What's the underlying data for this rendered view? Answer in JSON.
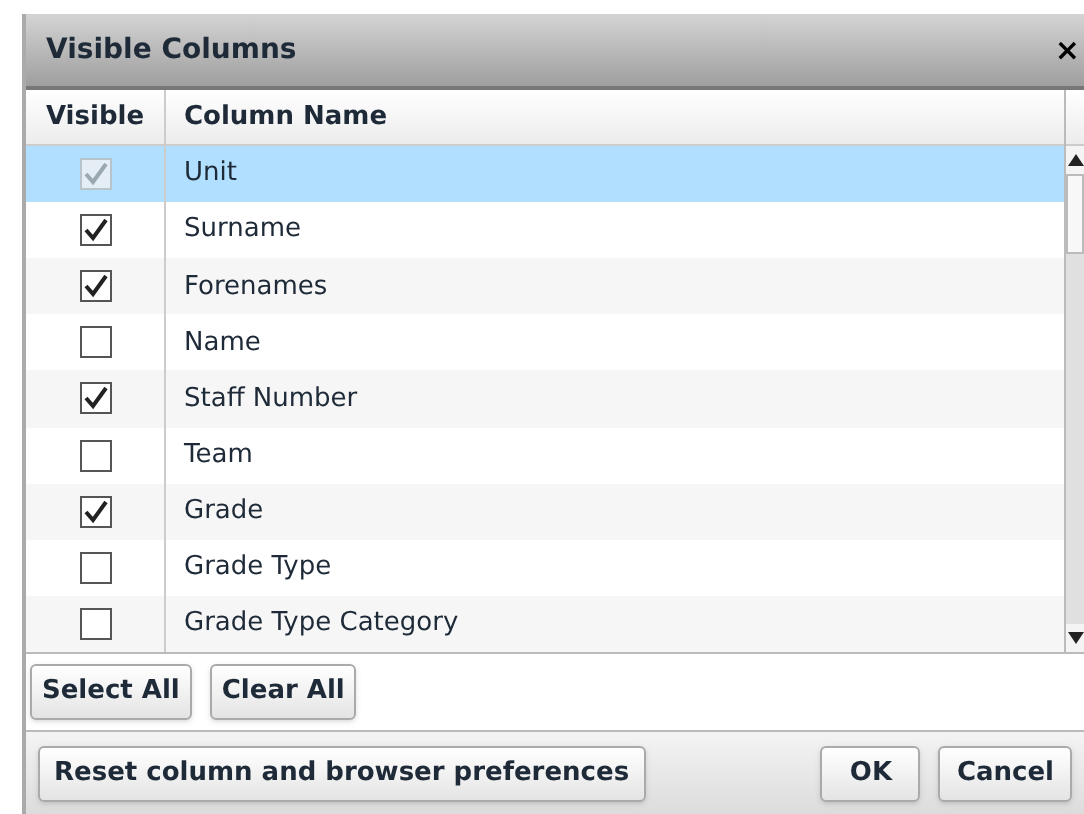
{
  "dialog": {
    "title": "Visible Columns",
    "close": "×"
  },
  "table": {
    "columns": [
      "Visible",
      "Column Name"
    ],
    "rows": [
      {
        "name": "Unit",
        "checked": true,
        "disabled": true,
        "selected": true
      },
      {
        "name": "Surname",
        "checked": true,
        "disabled": false,
        "selected": false
      },
      {
        "name": "Forenames",
        "checked": true,
        "disabled": false,
        "selected": false
      },
      {
        "name": "Name",
        "checked": false,
        "disabled": false,
        "selected": false
      },
      {
        "name": "Staff Number",
        "checked": true,
        "disabled": false,
        "selected": false
      },
      {
        "name": "Team",
        "checked": false,
        "disabled": false,
        "selected": false
      },
      {
        "name": "Grade",
        "checked": true,
        "disabled": false,
        "selected": false
      },
      {
        "name": "Grade Type",
        "checked": false,
        "disabled": false,
        "selected": false
      },
      {
        "name": "Grade Type Category",
        "checked": false,
        "disabled": false,
        "selected": false
      }
    ]
  },
  "selection_buttons": [
    "Select All",
    "Clear All"
  ],
  "footer": {
    "reset": "Reset column and browser preferences",
    "buttons": [
      "OK",
      "Cancel"
    ]
  }
}
